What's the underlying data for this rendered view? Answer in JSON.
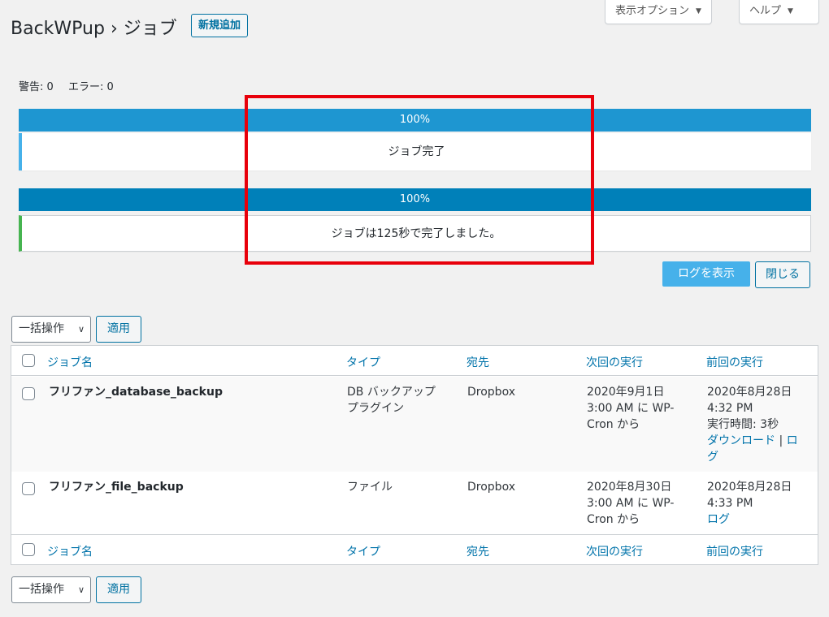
{
  "header": {
    "title": "BackWPup › ジョブ",
    "add_new": "新規追加",
    "screen_options": "表示オプション",
    "help": "ヘルプ"
  },
  "counts": {
    "warnings": "警告: 0",
    "errors": "エラー: 0"
  },
  "progress": {
    "bar1": {
      "percent_label": "100%",
      "value": 100,
      "message": "ジョブ完了",
      "color": "#1e96d1",
      "accent": "#46b1ea"
    },
    "bar2": {
      "percent_label": "100%",
      "value": 100,
      "message": "ジョブは125秒で完了しました。",
      "color": "#0080b9",
      "accent": "#46b450"
    }
  },
  "actions": {
    "show_log": "ログを表示",
    "close": "閉じる"
  },
  "bulk": {
    "label": "一括操作",
    "apply": "適用"
  },
  "table": {
    "columns": [
      "ジョブ名",
      "タイプ",
      "宛先",
      "次回の実行",
      "前回の実行"
    ],
    "rows": [
      {
        "name": "フリファン_database_backup",
        "type_lines": [
          "DB バックアップ",
          "プラグイン"
        ],
        "dest": "Dropbox",
        "next_lines": [
          "2020年9月1日",
          "3:00 AM に WP-",
          "Cron から"
        ],
        "last_lines": [
          "2020年8月28日",
          "4:32 PM",
          "実行時間: 3秒"
        ],
        "link_download": "ダウンロード",
        "link_sep": " | ",
        "link_log_a": "ロ",
        "link_log_b": "グ"
      },
      {
        "name": "フリファン_file_backup",
        "type_lines": [
          "ファイル"
        ],
        "dest": "Dropbox",
        "next_lines": [
          "2020年8月30日",
          "3:00 AM に WP-",
          "Cron から"
        ],
        "last_lines": [
          "2020年8月28日",
          "4:33 PM"
        ],
        "link_log": "ログ"
      }
    ]
  },
  "icons": {
    "dropdown": "chevron-down-icon",
    "screen_arrow": "triangle-down-icon"
  }
}
